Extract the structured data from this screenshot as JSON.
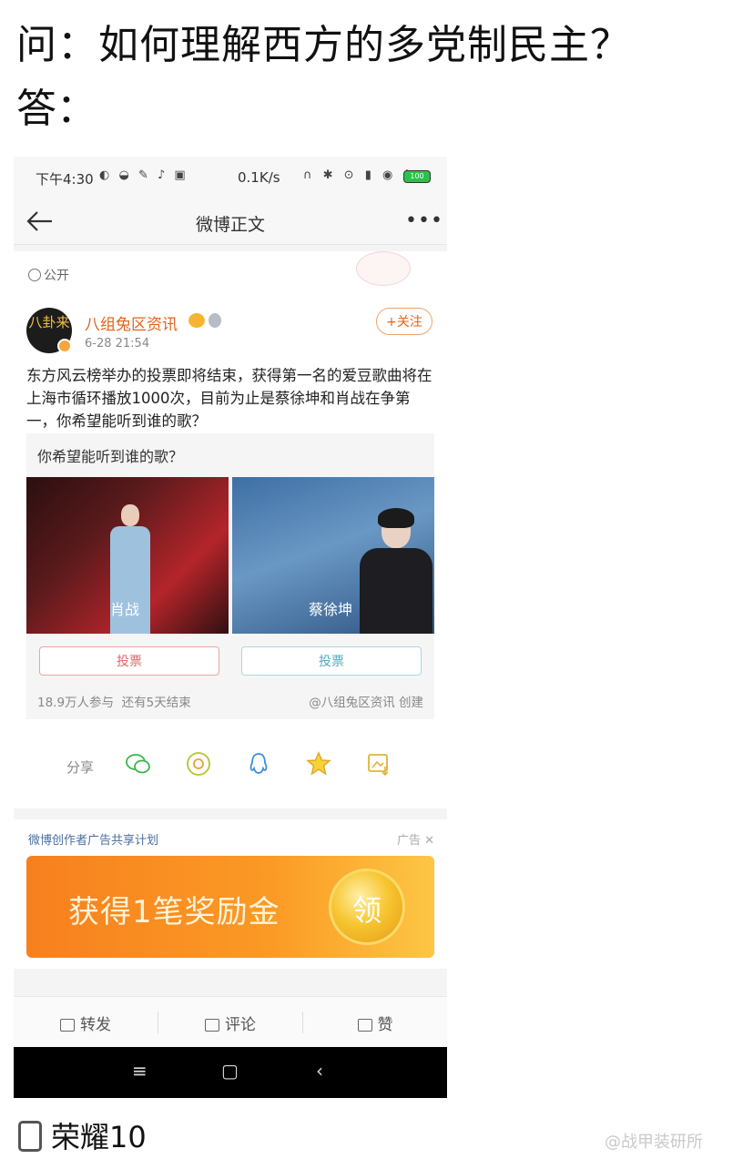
{
  "question": "问：如何理解西方的多党制民主？",
  "answer": "答：",
  "statusbar": {
    "time": "下午4:30",
    "rate": "0.1K/s",
    "battery": "100"
  },
  "navbar": {
    "title": "微博正文"
  },
  "post": {
    "visibility": "公开",
    "avatar_text": "八卦来",
    "author": "八组兔区资讯",
    "time": "6-28 21:54",
    "follow_label": "+关注",
    "text": "东方风云榜举办的投票即将结束，获得第一名的爱豆歌曲将在上海市循环播放1000次，目前为止是蔡徐坤和肖战在争第一，你希望能听到谁的歌？"
  },
  "poll": {
    "question": "你希望能听到谁的歌？",
    "options": [
      {
        "label": "肖战",
        "vote_label": "投票"
      },
      {
        "label": "蔡徐坤",
        "vote_label": "投票"
      }
    ],
    "participants": "18.9万人参与",
    "remaining": "还有5天结束",
    "creator": "@八组兔区资讯 创建"
  },
  "share": {
    "label": "分享",
    "icons": [
      "wechat-icon",
      "moments-icon",
      "qq-icon",
      "qzone-icon",
      "image-icon"
    ]
  },
  "ad": {
    "header": "微博创作者广告共享计划",
    "tag": "广告",
    "banner_text": "获得1笔奖励金",
    "coin_label": "领"
  },
  "actions": {
    "repost": "转发",
    "comment": "评论",
    "like": "赞"
  },
  "device": "荣耀10",
  "watermark": "@战甲装研所"
}
